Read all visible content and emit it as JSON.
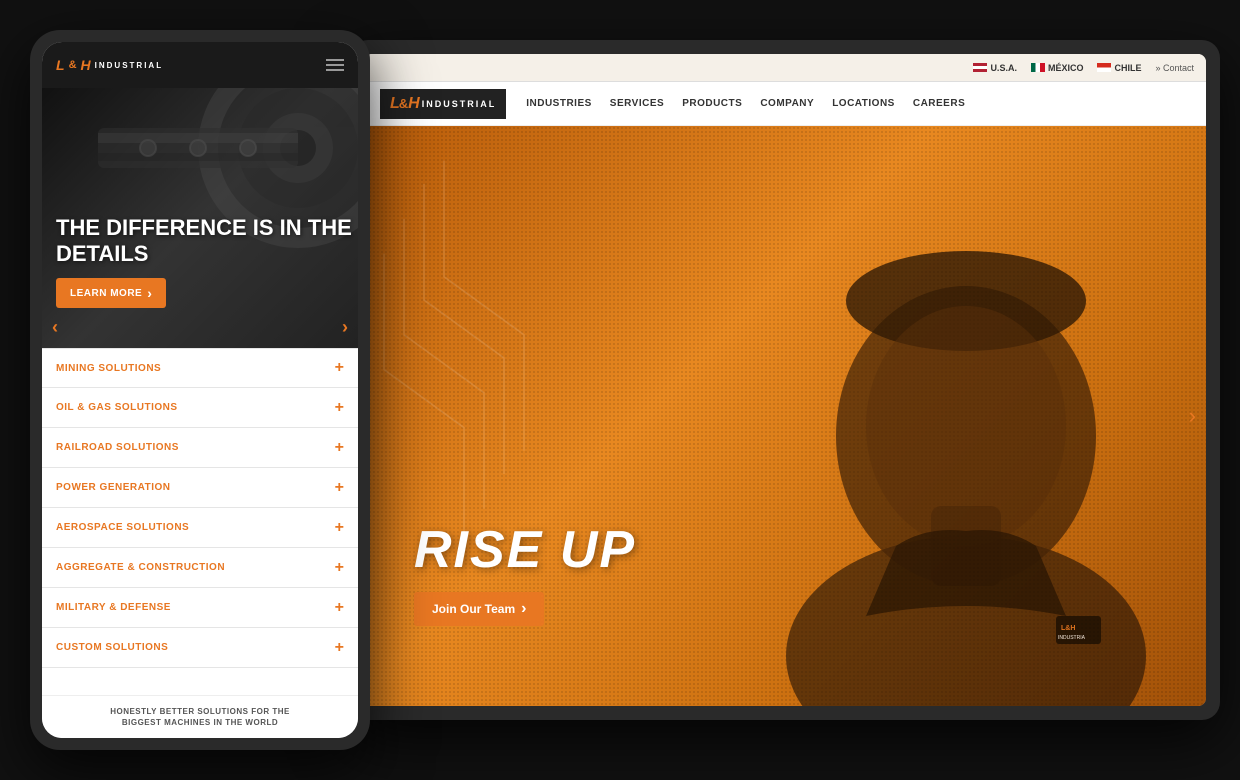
{
  "scene": {
    "bg_color": "#111111"
  },
  "phone": {
    "logo": {
      "lh": "L&H",
      "industrial": "INDUSTRIAL"
    },
    "hero": {
      "title": "THE DIFFERENCE IS IN THE DETAILS",
      "learn_more": "LEARN MORE"
    },
    "menu_items": [
      {
        "label": "MINING SOLUTIONS"
      },
      {
        "label": "OIL & GAS SOLUTIONS"
      },
      {
        "label": "RAILROAD SOLUTIONS"
      },
      {
        "label": "POWER GENERATION"
      },
      {
        "label": "AEROSPACE SOLUTIONS"
      },
      {
        "label": "AGGREGATE & CONSTRUCTION"
      },
      {
        "label": "MILITARY & DEFENSE"
      },
      {
        "label": "CUSTOM SOLUTIONS"
      }
    ],
    "footer": "HONESTLY BETTER SOLUTIONS FOR THE\nBIGGEST MACHINES IN THE WORLD"
  },
  "tablet": {
    "topbar": {
      "usa": "U.S.A.",
      "mexico": "MÉXICO",
      "chile": "CHILE",
      "contact": "» Contact"
    },
    "nav": {
      "logo": {
        "lh": "L&H",
        "industrial": "INDUSTRIAL"
      },
      "items": [
        "INDUSTRIES",
        "SERVICES",
        "PRODUCTS",
        "COMPANY",
        "LOCATIONS",
        "CAREERS"
      ]
    },
    "hero": {
      "title": "RISE UP",
      "join_team": "Join Our Team"
    }
  }
}
